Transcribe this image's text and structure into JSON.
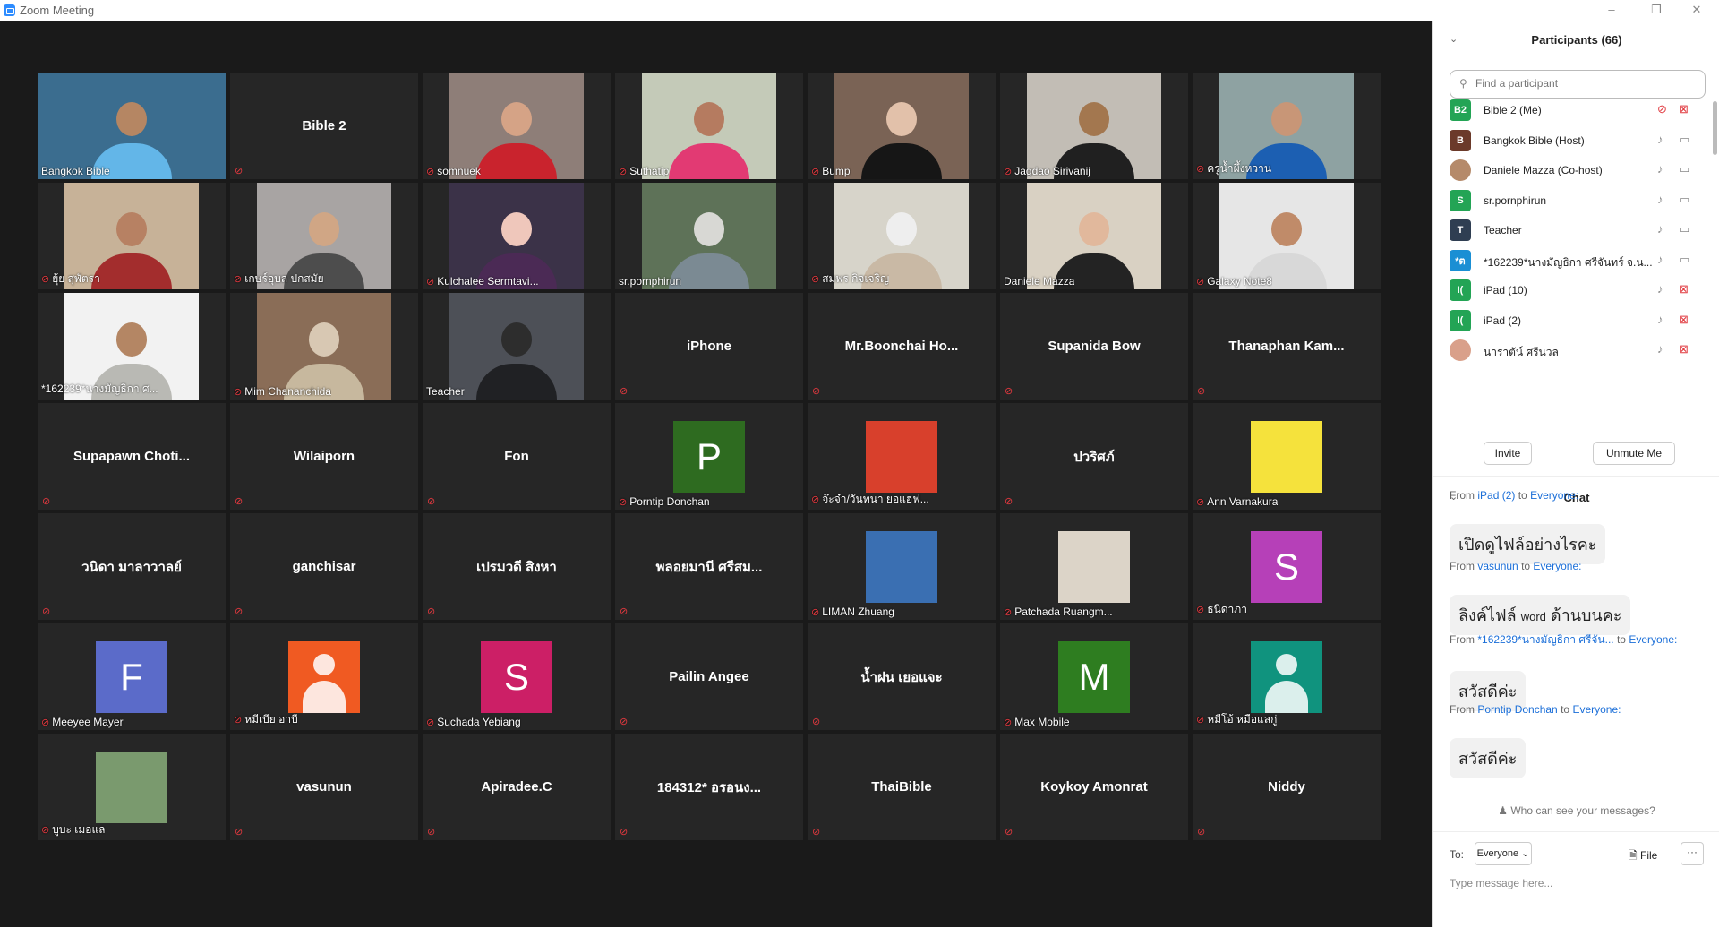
{
  "window": {
    "title": "Zoom Meeting",
    "minimize": "–",
    "maximize": "❐",
    "close": "✕"
  },
  "gallery": {
    "tiles": [
      {
        "name": "Bangkok Bible",
        "kind": "cam",
        "muted": false,
        "active": true,
        "bg": "#3b6d8f",
        "head": "#b58663",
        "body": "#63b6e8"
      },
      {
        "name": "Bible 2",
        "kind": "name",
        "muted": true
      },
      {
        "name": "somnuek",
        "kind": "cam",
        "muted": true,
        "bg": "#8e7e78",
        "head": "#d5a386",
        "body": "#c9232d"
      },
      {
        "name": "Suthatip",
        "kind": "cam",
        "muted": true,
        "bg": "#c4cab8",
        "head": "#b57b60",
        "body": "#e23a73"
      },
      {
        "name": "Bump",
        "kind": "cam",
        "muted": true,
        "bg": "#7a6355",
        "head": "#e2c1aa",
        "body": "#161616"
      },
      {
        "name": "Jagdao Sirivanij",
        "kind": "cam",
        "muted": true,
        "bg": "#c2bdb5",
        "head": "#a3774f",
        "body": "#202020"
      },
      {
        "name": "ครูน้ำผึ้งหวาน",
        "kind": "cam",
        "muted": true,
        "bg": "#8ea2a2",
        "head": "#c89677",
        "body": "#1c5fb2"
      },
      {
        "name": "ยุ้ย สุพัตรา",
        "kind": "cam",
        "muted": true,
        "bg": "#c7b298",
        "head": "#b78163",
        "body": "#a32d2d"
      },
      {
        "name": "เกษร์อุบล ปกสมัย",
        "kind": "cam",
        "muted": true,
        "bg": "#a8a4a3",
        "head": "#d0a685",
        "body": "#4d4d4d"
      },
      {
        "name": "Kulchalee Sermtavi...",
        "kind": "cam",
        "muted": true,
        "bg": "#3b3248",
        "head": "#efc7bb",
        "body": "#4b2a55"
      },
      {
        "name": "sr.pornphirun",
        "kind": "cam",
        "muted": false,
        "bg": "#5e7258",
        "head": "#d8d8d4",
        "body": "#7b8a93"
      },
      {
        "name": "สมพร กิจเจริญ",
        "kind": "cam",
        "muted": true,
        "bg": "#d7d4ca",
        "head": "#eeeeee",
        "body": "#c9b9a5"
      },
      {
        "name": "Daniele Mazza",
        "kind": "cam",
        "muted": false,
        "bg": "#d9d1c3",
        "head": "#e1b89c",
        "body": "#232323"
      },
      {
        "name": "Galaxy Note8",
        "kind": "cam",
        "muted": true,
        "bg": "#e6e6e6",
        "head": "#c08b69",
        "body": "#d8d8d8"
      },
      {
        "name": "*162239*นางมัญธิกา  ศ...",
        "kind": "cam",
        "muted": false,
        "bg": "#f2f2f2",
        "head": "#b48664",
        "body": "#b9b9b4"
      },
      {
        "name": "Mim Chananchida",
        "kind": "cam",
        "muted": true,
        "bg": "#8a6d57",
        "head": "#d8c8b3",
        "body": "#c7b89e"
      },
      {
        "name": "Teacher",
        "kind": "cam",
        "muted": false,
        "bg": "#4d5057",
        "head": "#2d2d2d",
        "body": "#202124"
      },
      {
        "name": "iPhone",
        "kind": "name",
        "muted": true
      },
      {
        "name": "Mr.Boonchai  Ho...",
        "kind": "name",
        "muted": true
      },
      {
        "name": "Supanida Bow",
        "kind": "name",
        "muted": true
      },
      {
        "name": "Thanaphan  Kam...",
        "kind": "name",
        "muted": true
      },
      {
        "name": "Supapawn  Choti...",
        "kind": "name",
        "muted": true
      },
      {
        "name": "Wilaiporn",
        "kind": "name",
        "muted": true
      },
      {
        "name": "Fon",
        "kind": "name",
        "muted": true
      },
      {
        "name": "Porntip Donchan",
        "kind": "letter",
        "letter": "P",
        "color": "#2e6b20",
        "muted": true
      },
      {
        "name": "จ๊ะจ๋า/วันทนา ยอแฮฟ...",
        "kind": "photo",
        "color": "#d8402c",
        "muted": true
      },
      {
        "name": "ปวริศภ์",
        "kind": "name",
        "muted": true
      },
      {
        "name": "Ann Varnakura",
        "kind": "photo",
        "color": "#f5e23c",
        "muted": true
      },
      {
        "name": "วนิดา มาลาวาลย์",
        "kind": "name",
        "muted": true
      },
      {
        "name": "ganchisar",
        "kind": "name",
        "muted": true
      },
      {
        "name": "เปรมวดี สิงหา",
        "kind": "name",
        "muted": true
      },
      {
        "name": "พลอยมานี ศรีสม...",
        "kind": "name",
        "muted": true
      },
      {
        "name": "LIMAN Zhuang",
        "kind": "photo",
        "color": "#3a6fb2",
        "muted": true
      },
      {
        "name": "Patchada Ruangm...",
        "kind": "photo",
        "color": "#dcd4c8",
        "muted": true
      },
      {
        "name": "ธนิดาภา",
        "kind": "letter",
        "letter": "S",
        "color": "#b640b8",
        "muted": true
      },
      {
        "name": "Meeyee Mayer",
        "kind": "letter",
        "letter": "F",
        "color": "#5b6bc9",
        "muted": true
      },
      {
        "name": "หมีเบีย อาบี",
        "kind": "person",
        "color": "#f05a22",
        "muted": true
      },
      {
        "name": "Suchada Yebiang",
        "kind": "letter",
        "letter": "S",
        "color": "#cc1f66",
        "muted": true
      },
      {
        "name": "Pailin Angee",
        "kind": "name",
        "muted": true
      },
      {
        "name": "น้ำฝน เยอแจะ",
        "kind": "name",
        "muted": true
      },
      {
        "name": "Max Mobile",
        "kind": "letter",
        "letter": "M",
        "color": "#2e7d20",
        "muted": true
      },
      {
        "name": "หมีโอ้ หมือแลกู่",
        "kind": "person",
        "color": "#10937e",
        "muted": true
      },
      {
        "name": "บูบะ เมอแล",
        "kind": "photo",
        "color": "#7a9a6e",
        "muted": true
      },
      {
        "name": "vasunun",
        "kind": "name",
        "muted": true
      },
      {
        "name": "Apiradee.C",
        "kind": "name",
        "muted": true
      },
      {
        "name": "184312* อรอนง...",
        "kind": "name",
        "muted": true
      },
      {
        "name": "ThaiBible",
        "kind": "name",
        "muted": true
      },
      {
        "name": "Koykoy Amonrat",
        "kind": "name",
        "muted": true
      },
      {
        "name": "Niddy",
        "kind": "name",
        "muted": true
      }
    ]
  },
  "participants": {
    "title": "Participants (66)",
    "search_placeholder": "Find a participant",
    "items": [
      {
        "name": "Bible 2 (Me)",
        "avatar": "B2",
        "color": "#23a455",
        "mic_off": true,
        "cam_off": true
      },
      {
        "name": "Bangkok Bible (Host)",
        "avatar": "B",
        "color": "#6b3a2a",
        "mic_off": false,
        "cam_off": false
      },
      {
        "name": "Daniele Mazza (Co-host)",
        "avatar": "",
        "color": "#b58a6a",
        "mic_off": false,
        "cam_off": false
      },
      {
        "name": "sr.pornphirun",
        "avatar": "S",
        "color": "#23a455",
        "mic_off": false,
        "cam_off": false
      },
      {
        "name": "Teacher",
        "avatar": "T",
        "color": "#2f3e52",
        "mic_off": false,
        "cam_off": false
      },
      {
        "name": "*162239*นางมัญธิกา  ศรีจันทร์ จ.น...",
        "avatar": "*ต",
        "color": "#1a8fd4",
        "mic_off": false,
        "cam_off": false
      },
      {
        "name": "iPad (10)",
        "avatar": "I(",
        "color": "#23a455",
        "mic_off": false,
        "cam_off": true
      },
      {
        "name": "iPad (2)",
        "avatar": "I(",
        "color": "#23a455",
        "mic_off": false,
        "cam_off": true
      },
      {
        "name": "นาราตัน์ ศรีนวล",
        "avatar": "",
        "color": "#d9a08a",
        "mic_off": false,
        "cam_off": true
      }
    ],
    "invite": "Invite",
    "unmute": "Unmute Me"
  },
  "chat": {
    "title": "Chat",
    "messages": [
      {
        "from_label": "From",
        "sender": "iPad (2)",
        "to_label": "to",
        "recipient": "Everyone:",
        "text": "เปิดดูไฟล์อย่างไรคะ"
      },
      {
        "from_label": "From",
        "sender": "vasunun",
        "to_label": "to",
        "recipient": "Everyone:",
        "text_pre": "ลิงค์ไฟล์",
        "text_small": "word",
        "text_post": "ด้านบนคะ"
      },
      {
        "from_label": "From",
        "sender": "*162239*นางมัญธิกา  ศรีจัน...",
        "to_label": "to",
        "recipient": "Everyone:",
        "text": "สวัสดีค่ะ"
      },
      {
        "from_label": "From",
        "sender": "Porntip Donchan",
        "to_label": "to",
        "recipient": "Everyone:",
        "text": "สวัสดีค่ะ"
      }
    ],
    "visibility_notice": "Who can see your messages?",
    "to_label": "To:",
    "recipient_select": "Everyone",
    "file_label": "File",
    "more_label": "···",
    "input_placeholder": "Type message here..."
  }
}
